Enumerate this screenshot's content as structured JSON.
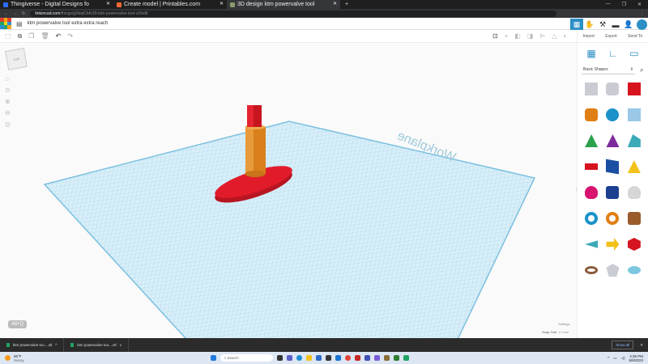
{
  "browser": {
    "tabs": [
      {
        "label": "Thingiverse - Digital Designs fo",
        "color": "#2d6bff"
      },
      {
        "label": "Create model | Printables.com",
        "color": "#fa6831"
      },
      {
        "label": "3D design ktm powervalve tool",
        "color": "#8a9a6a",
        "active": true
      }
    ],
    "new_tab": "+",
    "url_host": "tinkercad.com",
    "url_path": "/things/gSkqtCbKrDt-ktm-powervalve-tool-v2/edit"
  },
  "app": {
    "title": "ktm powervalve tool extra extra reach",
    "actions": {
      "import": "Import",
      "export": "Export",
      "send_to": "Send To"
    },
    "shape_category": "Basic Shapes",
    "workplane_label": "Workplane",
    "settings": "Settings",
    "snap_grid_label": "Snap Grid",
    "snap_grid_value": "1.0 mm",
    "shortcut_badge": "Alt+Q",
    "view_cube": "TOP"
  },
  "downloads": {
    "items": [
      "ktm powervalve too....stl",
      "ktm powervalve too....stl"
    ],
    "show_all": "Show all"
  },
  "taskbar": {
    "weather_temp": "86°F",
    "weather_desc": "Sunny",
    "search_placeholder": "Search",
    "time": "4:36 PM",
    "date": "6/8/2023"
  }
}
